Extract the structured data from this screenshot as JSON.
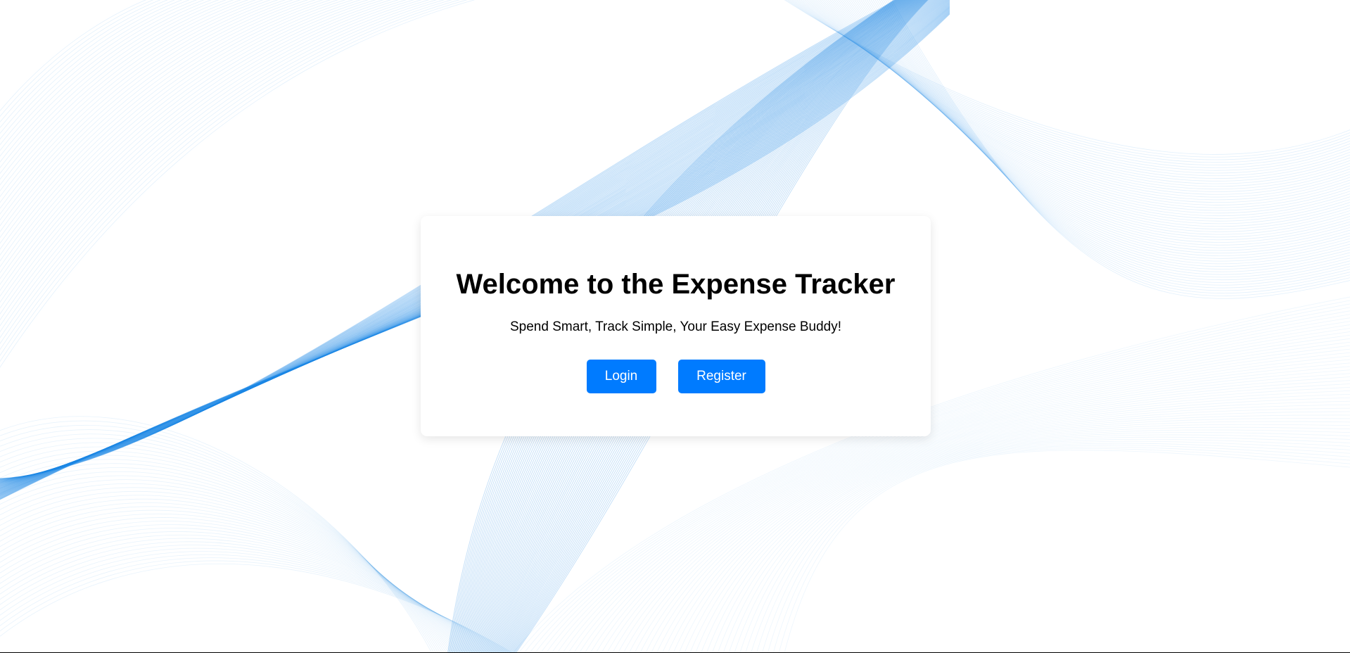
{
  "welcome": {
    "title": "Welcome to the Expense Tracker",
    "tagline": "Spend Smart, Track Simple, Your Easy Expense Buddy!",
    "login_label": "Login",
    "register_label": "Register"
  },
  "theme": {
    "accent": "#007bff",
    "background_wave": "#1e88e5",
    "card_background": "#ffffff"
  },
  "background": {
    "icon": "blue-line-wave-pattern"
  }
}
